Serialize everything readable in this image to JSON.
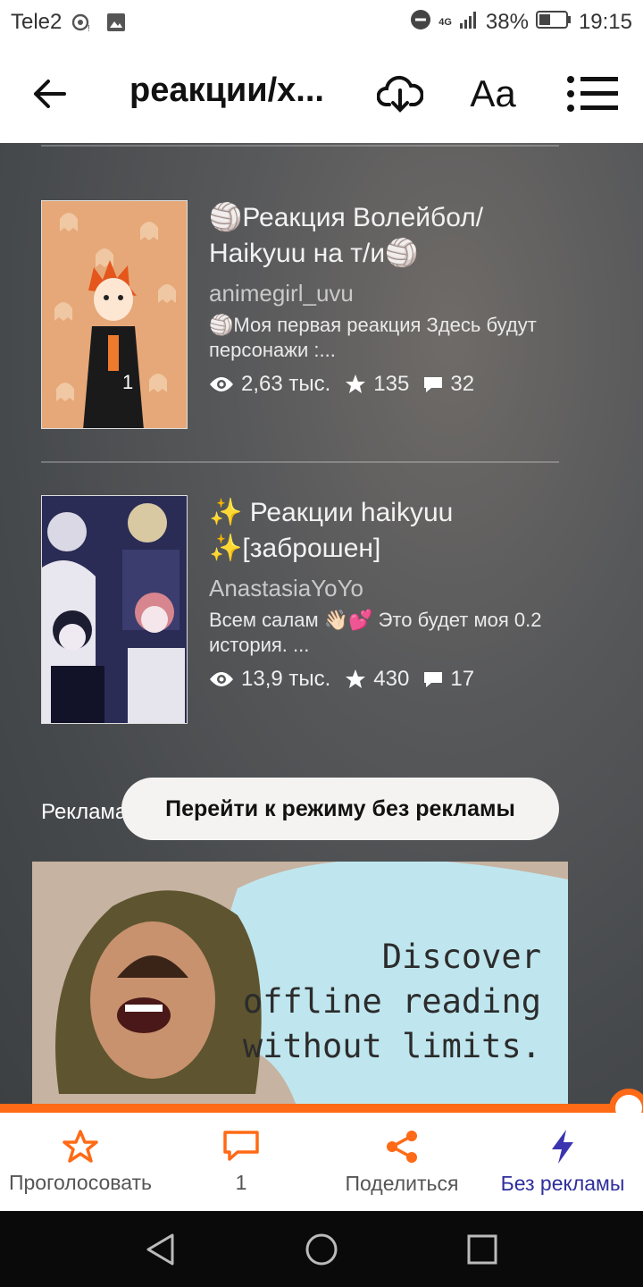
{
  "status_bar": {
    "carrier": "Tele2",
    "network": "4G",
    "battery": "38%",
    "time": "19:15"
  },
  "app_bar": {
    "title": "реакции/х...",
    "font_label": "Aa",
    "icons": [
      "back-arrow-icon",
      "download-icon",
      "list-menu-icon"
    ]
  },
  "stories": [
    {
      "title": "🏐Реакция Волейбол/ Haikyuu на т/и🏐",
      "author": "animegirl_uvu",
      "description": "🏐Моя первая реакция Здесь будут персонажи :...",
      "views": "2,63 тыс.",
      "stars": "135",
      "comments": "32"
    },
    {
      "title": "✨ Реакции haikyuu ✨[заброшен]",
      "author": "AnastasiaYoYo",
      "description": "Всем салам 👋🏻💕 Это будет моя 0.2 история. ...",
      "views": "13,9 тыс.",
      "stars": "430",
      "comments": "17"
    }
  ],
  "ad": {
    "label": "Реклама",
    "no_ads_button": "Перейти к режиму без рекламы",
    "banner_line1": "Discover",
    "banner_line2": "offline reading",
    "banner_line3": "without limits."
  },
  "reading_progress": 1.0,
  "toolbar": {
    "vote_label": "Проголосовать",
    "comments_count": "1",
    "share_label": "Поделиться",
    "no_ads_label": "Без рекламы"
  },
  "colors": {
    "accent_orange": "#ff6a16",
    "accent_indigo": "#2f2e9c"
  }
}
